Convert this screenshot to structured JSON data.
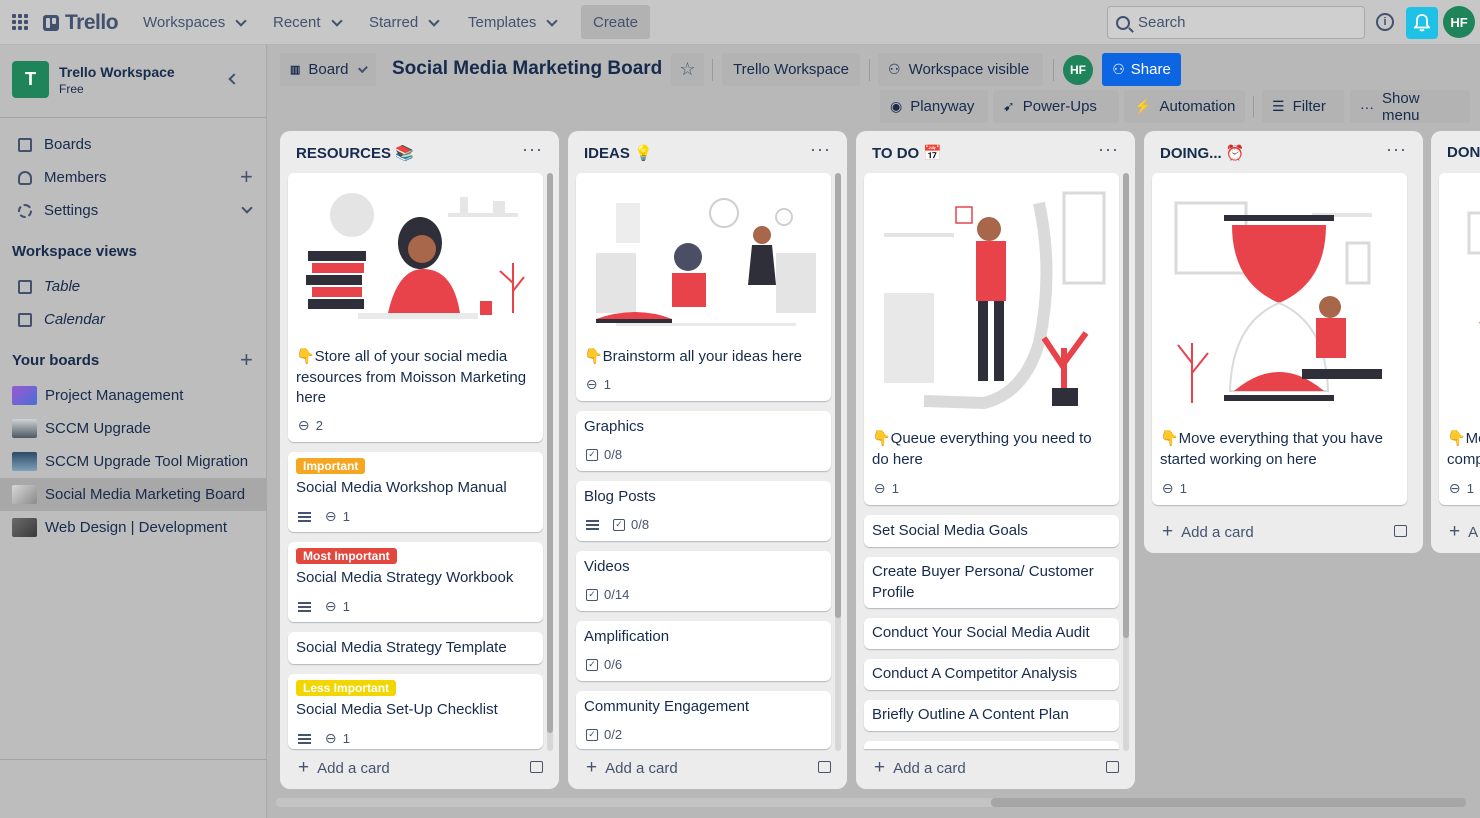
{
  "topbar": {
    "logo": "Trello",
    "nav": [
      {
        "label": "Workspaces"
      },
      {
        "label": "Recent"
      },
      {
        "label": "Starred"
      },
      {
        "label": "Templates"
      }
    ],
    "create_label": "Create",
    "search_placeholder": "Search",
    "avatar_initials": "HF"
  },
  "sidebar": {
    "workspace_name": "Trello Workspace",
    "workspace_plan": "Free",
    "items": [
      {
        "label": "Boards"
      },
      {
        "label": "Members"
      },
      {
        "label": "Settings"
      }
    ],
    "views_heading": "Workspace views",
    "views": [
      {
        "label": "Table"
      },
      {
        "label": "Calendar"
      }
    ],
    "boards_heading": "Your boards",
    "boards": [
      {
        "label": "Project Management",
        "color": "#7b5cd6"
      },
      {
        "label": "SCCM Upgrade",
        "color": "#6f7d87"
      },
      {
        "label": "SCCM Upgrade Tool Migration",
        "color": "#3a4f66"
      },
      {
        "label": "Social Media Marketing Board",
        "color": "#9a9a9a"
      },
      {
        "label": "Web Design | Development",
        "color": "#5a5a5a"
      }
    ]
  },
  "board_header": {
    "view_label": "Board",
    "title": "Social Media Marketing Board",
    "workspace_label": "Trello Workspace",
    "visibility_label": "Workspace visible",
    "member_initials": "HF",
    "share_label": "Share",
    "planyway_label": "Planyway",
    "powerups_label": "Power-Ups",
    "automation_label": "Automation",
    "filter_label": "Filter",
    "show_menu_label": "Show menu"
  },
  "lists": [
    {
      "title": "RESOURCES 📚",
      "cards": [
        {
          "text": "👇Store all of your social media resources from Moisson Marketing here",
          "attachments": "2"
        },
        {
          "label": "Important",
          "label_color": "#f5a623",
          "text": "Social Media Workshop Manual",
          "attachments": "1"
        },
        {
          "label": "Most Important",
          "label_color": "#e2483d",
          "text": "Social Media Strategy Workbook",
          "attachments": "1"
        },
        {
          "text": "Social Media Strategy Template"
        },
        {
          "label": "Less Important",
          "label_color": "#f2d600",
          "text": "Social Media Set-Up Checklist",
          "attachments": "1"
        }
      ],
      "add_label": "Add a card"
    },
    {
      "title": "IDEAS 💡",
      "cards": [
        {
          "text": "👇Brainstorm all your ideas here",
          "attachments": "1"
        },
        {
          "text": "Graphics",
          "checklist": "0/8"
        },
        {
          "text": "Blog Posts",
          "checklist": "0/8"
        },
        {
          "text": "Videos",
          "checklist": "0/14"
        },
        {
          "text": "Amplification",
          "checklist": "0/6"
        },
        {
          "text": "Community Engagement",
          "checklist": "0/2"
        }
      ],
      "add_label": "Add a card"
    },
    {
      "title": "TO DO 📅",
      "cards": [
        {
          "text": "👇Queue everything you need to do here",
          "attachments": "1"
        },
        {
          "text": "Set Social Media Goals"
        },
        {
          "text": "Create Buyer Persona/ Customer Profile"
        },
        {
          "text": "Conduct Your Social Media Audit"
        },
        {
          "text": "Conduct A Competitor Analysis"
        },
        {
          "text": "Briefly Outline A Content Plan"
        }
      ],
      "add_label": "Add a card"
    },
    {
      "title": "DOING... ⏰",
      "cards": [
        {
          "text": "👇Move everything that you have started working on here",
          "attachments": "1"
        }
      ],
      "add_label": "Add a card"
    },
    {
      "title": "DON",
      "cards": [
        {
          "text": "👇Mo comp",
          "attachments": "1"
        }
      ],
      "add_label": "A"
    }
  ],
  "colors": {
    "accent": "#0c66e4",
    "workspace_green": "#1f845a",
    "notification": "#1fc1e6",
    "illustration_red": "#e8434a"
  }
}
